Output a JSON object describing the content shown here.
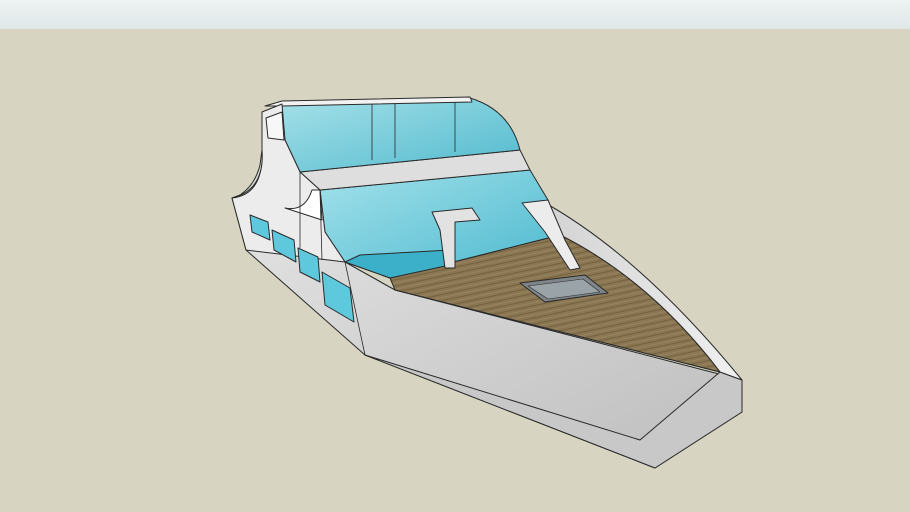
{
  "scene": {
    "sky_color": "#e6eeee",
    "ground_color": "#d7d5c2",
    "model_subject": "boat-3d-model",
    "materials": {
      "hull": "#d9d9d9",
      "hull_shadow": "#b8b8b8",
      "glass": "#5ec8dc",
      "glass_light": "#a8e4ef",
      "deck_wood": "#8a7652",
      "edge_line": "#2a2a2a"
    }
  }
}
